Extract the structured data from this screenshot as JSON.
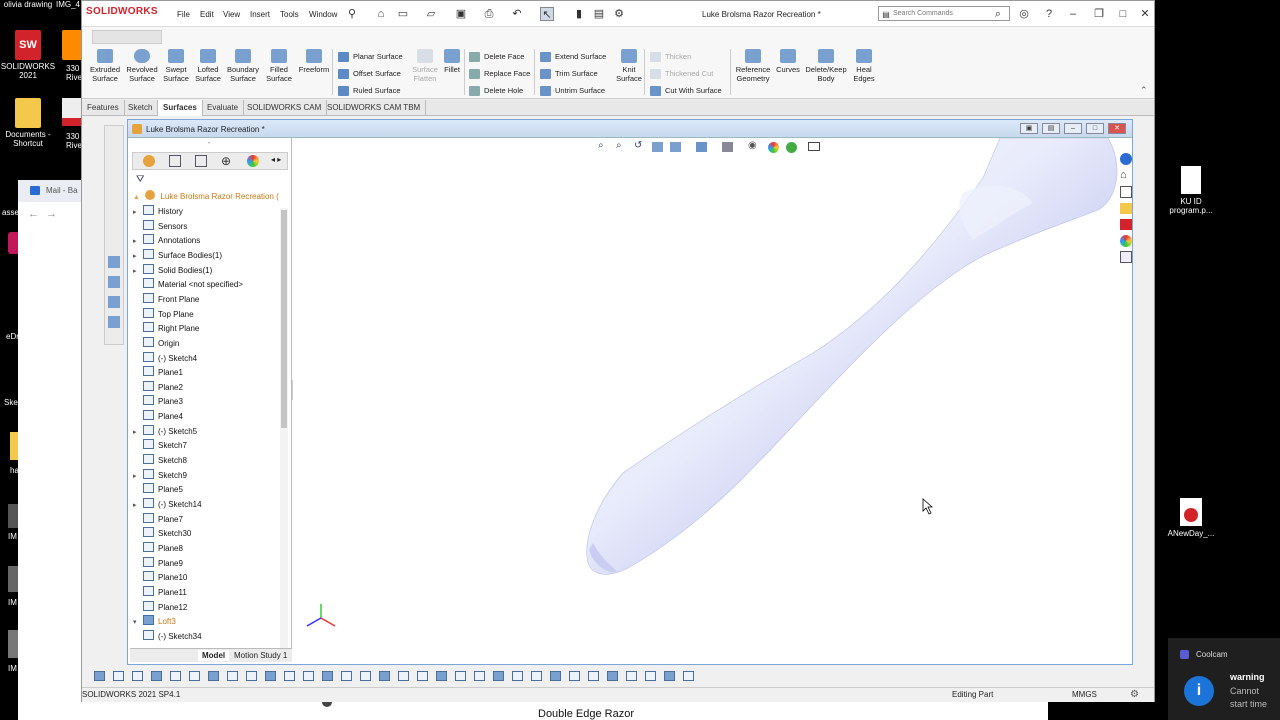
{
  "desktop": {
    "left_icons": [
      {
        "label": "olivia drawing",
        "color": "#f5f5f5"
      },
      {
        "label": "SOLIDWORKS 2021",
        "color": "#d2232a"
      },
      {
        "label": "Documents - Shortcut",
        "color": "#f3c84b"
      }
    ],
    "partial_labels": [
      "IMG_4",
      "330 Riverv",
      "330 Riverv",
      "Ske",
      "assem",
      "eDr",
      "Ske",
      "ha",
      "IM",
      "IM",
      "IM"
    ],
    "right_icons": [
      {
        "label": "KU ID program.p...",
        "type": "file"
      },
      {
        "label": "ANewDay_...",
        "type": "pdf"
      }
    ],
    "mail_tab": "Mail - Ba"
  },
  "app": {
    "brand": "SOLIDWORKS",
    "menu": [
      "File",
      "Edit",
      "View",
      "Insert",
      "Tools",
      "Window"
    ],
    "document_title": "Luke Brolsma Razor Recreation *",
    "search_placeholder": "Search Commands",
    "accent": "#d2232a"
  },
  "ribbon": {
    "big_buttons": [
      {
        "label": "Extruded Surface",
        "icon": "extruded-surface-icon"
      },
      {
        "label": "Revolved Surface",
        "icon": "revolved-surface-icon"
      },
      {
        "label": "Swept Surface",
        "icon": "swept-surface-icon"
      },
      {
        "label": "Lofted Surface",
        "icon": "lofted-surface-icon"
      },
      {
        "label": "Boundary Surface",
        "icon": "boundary-surface-icon"
      },
      {
        "label": "Filled Surface",
        "icon": "filled-surface-icon"
      },
      {
        "label": "Freeform",
        "icon": "freeform-icon"
      }
    ],
    "col1": [
      "Planar Surface",
      "Offset Surface",
      "Ruled Surface"
    ],
    "surface_flatten": "Surface Flatten",
    "fillet": "Fillet",
    "col2": [
      "Delete Face",
      "Replace Face",
      "Delete Hole"
    ],
    "col3": [
      "Extend Surface",
      "Trim Surface",
      "Untrim Surface"
    ],
    "knit": "Knit Surface",
    "col4": [
      "Thicken",
      "Thickened Cut",
      "Cut With Surface"
    ],
    "big_right": [
      "Reference Geometry",
      "Curves",
      "Delete/Keep Body",
      "Heal Edges"
    ]
  },
  "tabs": [
    "Features",
    "Sketch",
    "Surfaces",
    "Evaluate",
    "SOLIDWORKS CAM",
    "SOLIDWORKS CAM TBM"
  ],
  "active_tab": "Surfaces",
  "doc_window": {
    "title": "Luke Brolsma Razor Recreation *"
  },
  "tree": {
    "root": "Luke Brolsma Razor Recreation  (",
    "items": [
      {
        "label": "History",
        "expand": true
      },
      {
        "label": "Sensors",
        "expand": false
      },
      {
        "label": "Annotations",
        "expand": true
      },
      {
        "label": "Surface Bodies(1)",
        "expand": true
      },
      {
        "label": "Solid Bodies(1)",
        "expand": true
      },
      {
        "label": "Material <not specified>",
        "expand": false
      },
      {
        "label": "Front Plane",
        "expand": false
      },
      {
        "label": "Top Plane",
        "expand": false
      },
      {
        "label": "Right Plane",
        "expand": false
      },
      {
        "label": "Origin",
        "expand": false
      },
      {
        "label": "(-) Sketch4",
        "expand": false
      },
      {
        "label": "Plane1",
        "expand": false
      },
      {
        "label": "Plane2",
        "expand": false
      },
      {
        "label": "Plane3",
        "expand": false
      },
      {
        "label": "Plane4",
        "expand": false
      },
      {
        "label": "(-) Sketch5",
        "expand": true
      },
      {
        "label": "Sketch7",
        "expand": false
      },
      {
        "label": "Sketch8",
        "expand": false
      },
      {
        "label": "Sketch9",
        "expand": true
      },
      {
        "label": "Plane5",
        "expand": false
      },
      {
        "label": "(-) Sketch14",
        "expand": true
      },
      {
        "label": "Plane7",
        "expand": false
      },
      {
        "label": "Sketch30",
        "expand": false
      },
      {
        "label": "Plane8",
        "expand": false
      },
      {
        "label": "Plane9",
        "expand": false
      },
      {
        "label": "Plane10",
        "expand": false
      },
      {
        "label": "Plane11",
        "expand": false
      },
      {
        "label": "Plane12",
        "expand": false
      },
      {
        "label": "Loft3",
        "expand": true
      },
      {
        "label": "(-) Sketch34",
        "expand": false
      }
    ]
  },
  "bottom_tabs": [
    "Model",
    "Motion Study 1"
  ],
  "status": {
    "left": "SOLIDWORKS 2021 SP4.1",
    "mode": "Editing Part",
    "units": "MMGS"
  },
  "notification": {
    "app": "Coolcam",
    "title": "warning",
    "text": "Cannot start time"
  },
  "caption": "Double Edge Razor"
}
